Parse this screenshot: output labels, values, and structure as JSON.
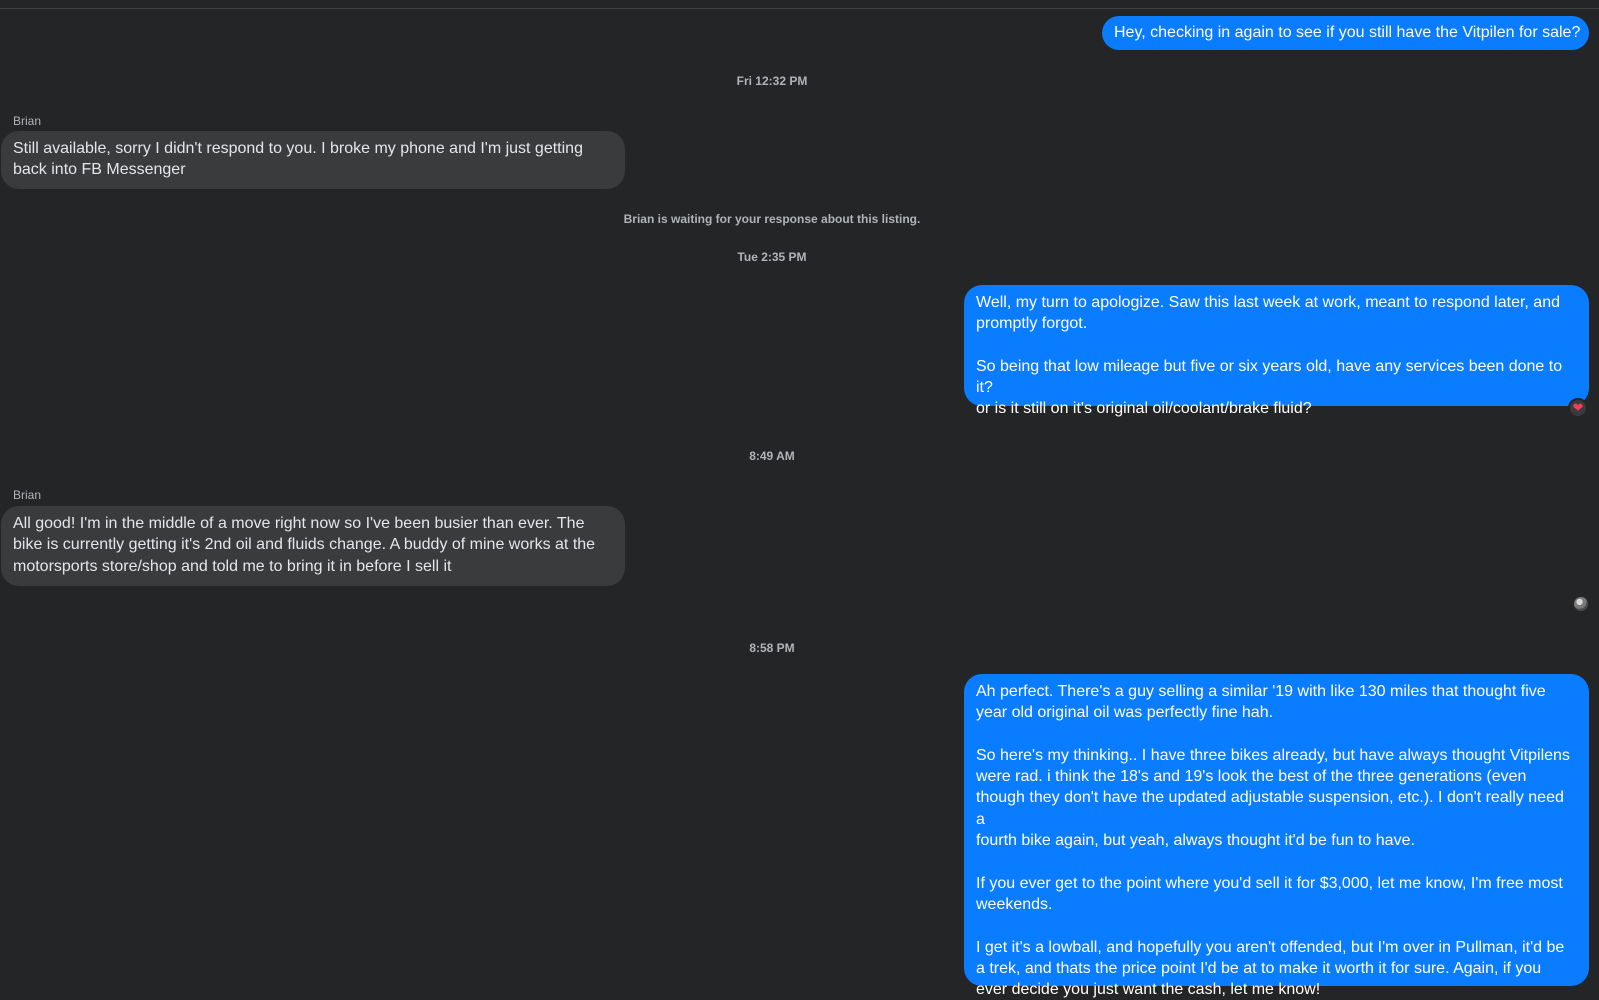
{
  "messages": [
    {
      "text": "Hey, checking in again to see if you still have the Vitpilen for sale?"
    },
    {
      "timestamp": "Fri 12:32 PM"
    },
    {
      "sender": "Brian",
      "text": "Still available, sorry I didn't respond to you. I broke my phone and I'm just getting\nback into FB Messenger"
    },
    {
      "notice": "Brian is waiting for your response about this listing."
    },
    {
      "timestamp": "Tue 2:35 PM"
    },
    {
      "text": "Well, my turn to apologize. Saw this last week at work, meant to respond later, and\npromptly forgot.\n\nSo being that low mileage but five or six years old, have any services been done to it?\nor is it still on it's original oil/coolant/brake fluid?",
      "reaction": "❤"
    },
    {
      "timestamp": "8:49 AM"
    },
    {
      "sender": "Brian",
      "text": "All good! I'm in the middle of a move right now so I've been busier than ever. The\nbike is currently getting it's 2nd oil and fluids change. A buddy of mine works at the\nmotorsports store/shop and told me to bring it in before I sell it"
    },
    {
      "timestamp": "8:58 PM"
    },
    {
      "text": "Ah perfect. There's a guy selling a similar '19 with like 130 miles that thought five\nyear old original oil was perfectly fine hah.\n\nSo here's my thinking.. I have three bikes already, but have always thought Vitpilens\nwere rad. i think the 18's and 19's look the best of the three generations (even\nthough they don't have the updated adjustable suspension, etc.). I don't really need a\nfourth bike again, but yeah, always thought it'd be fun to have.\n\nIf you ever get to the point where you'd sell it for $3,000, let me know, I'm free most\nweekends.\n\nI get it's a lowball, and hopefully you aren't offended, but I'm over in Pullman, it'd be\na trek, and thats the price point I'd be at to make it worth it for sure. Again, if you\never decide you just want the cash, let me know!"
    }
  ],
  "colors": {
    "background": "#242526",
    "outgoing_bubble": "#0a7cff",
    "incoming_bubble": "#3a3b3c",
    "meta_text": "#b0b3b8"
  }
}
